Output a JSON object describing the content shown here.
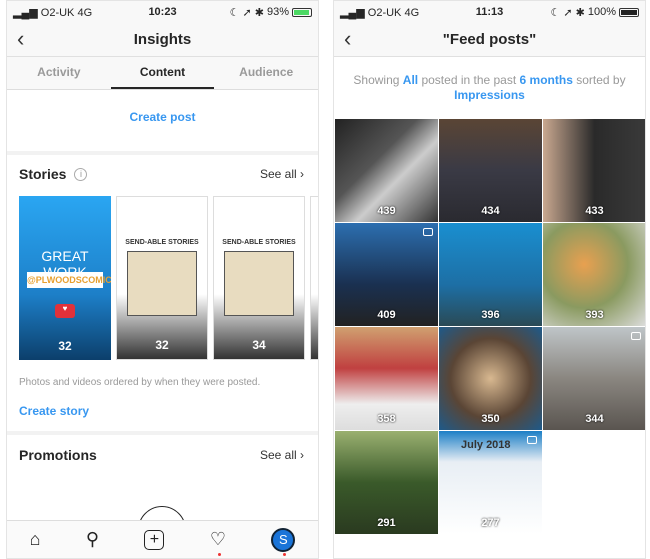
{
  "left": {
    "status": {
      "carrier": "O2-UK",
      "network": "4G",
      "time": "10:23",
      "battery": "93%",
      "battery_color": "#4cd964"
    },
    "title": "Insights",
    "tabs": [
      "Activity",
      "Content",
      "Audience"
    ],
    "active_tab": "Content",
    "create_post": "Create post",
    "stories": {
      "heading": "Stories",
      "see_all": "See all",
      "items": [
        {
          "text": "GREAT WORK",
          "handle": "@PLWOODSCOMICS",
          "count": "32"
        },
        {
          "title": "SEND-ABLE STORIES",
          "count": "32"
        },
        {
          "title": "SEND-ABLE STORIES",
          "count": "34"
        }
      ],
      "note": "Photos and videos ordered by when they were posted.",
      "create_story": "Create story"
    },
    "promotions": {
      "heading": "Promotions",
      "see_all": "See all"
    },
    "bottom_nav": [
      "home-icon",
      "search-icon",
      "add-post-icon",
      "heart-icon",
      "profile-icon"
    ]
  },
  "right": {
    "status": {
      "carrier": "O2-UK",
      "network": "4G",
      "time": "11:13",
      "battery": "100%"
    },
    "title": "\"Feed posts\"",
    "filter": {
      "p1": "Showing ",
      "all": "All",
      "p2": " posted in the past ",
      "period": "6 months",
      "p3": " sorted by ",
      "sort": "Impressions"
    },
    "posts": [
      "439",
      "434",
      "433",
      "409",
      "396",
      "393",
      "358",
      "350",
      "344",
      "291",
      "277"
    ],
    "calendar_text": "July 2018"
  },
  "colors": {
    "accent": "#3897f0"
  }
}
